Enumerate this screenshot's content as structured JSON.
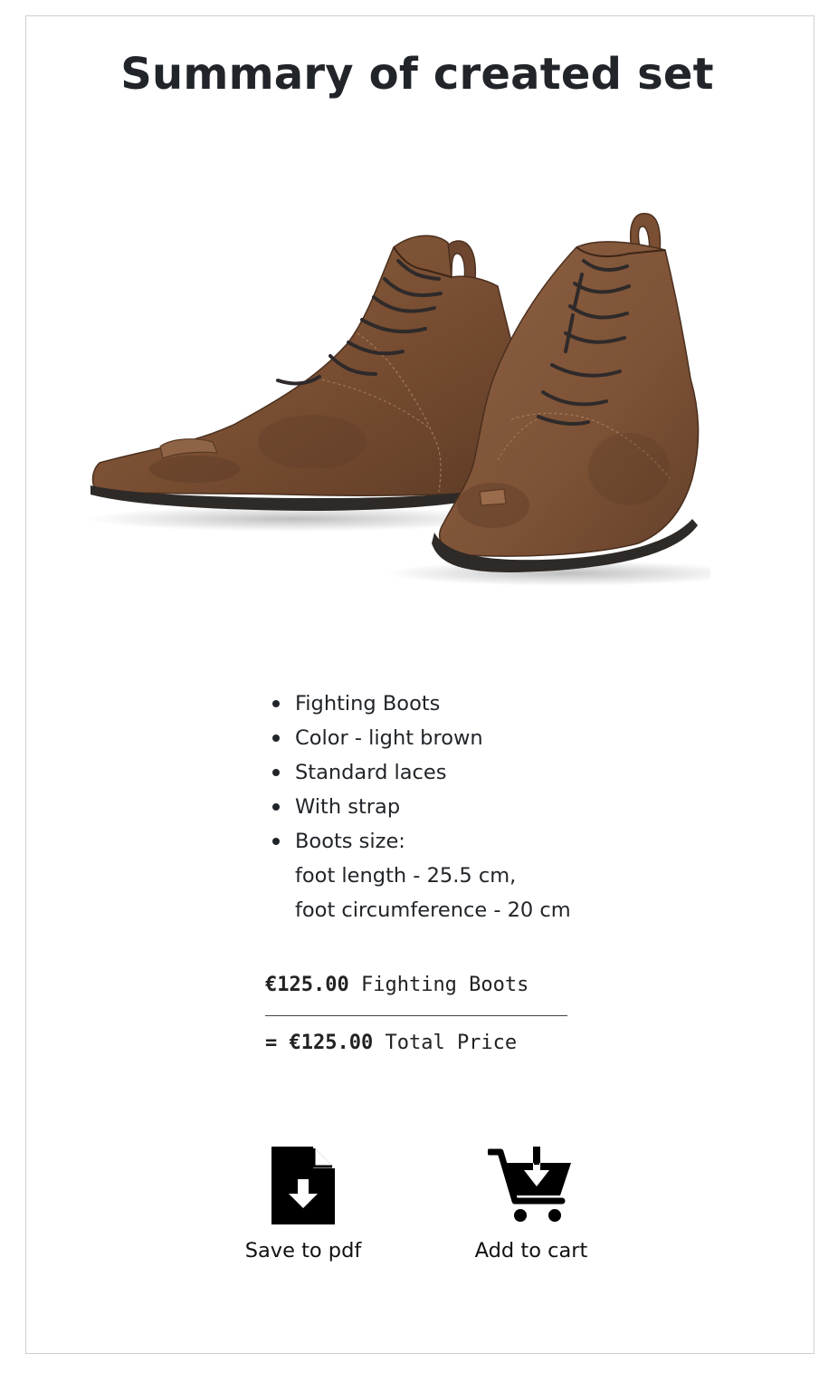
{
  "summary": {
    "title": "Summary of created set"
  },
  "product": {
    "image_alt": "Fighting Boots light brown",
    "features": [
      [
        "Fighting Boots"
      ],
      [
        "Color - light brown"
      ],
      [
        "Standard laces"
      ],
      [
        "With strap"
      ],
      [
        "Boots size:",
        "foot length - 25.5 cm,",
        "foot circumference - 20 cm"
      ]
    ]
  },
  "pricing": {
    "line_items": [
      {
        "amount": "€125.00",
        "label": "Fighting Boots"
      }
    ],
    "total": {
      "prefix": "= ",
      "amount": "€125.00",
      "label": "Total Price"
    }
  },
  "actions": {
    "save_pdf": {
      "label": "Save to pdf",
      "icon": "file-download-icon"
    },
    "add_cart": {
      "label": "Add to cart",
      "icon": "cart-download-icon"
    }
  },
  "colors": {
    "leather": "#7a4f33",
    "sole": "#2e2a27",
    "text": "#212529"
  }
}
